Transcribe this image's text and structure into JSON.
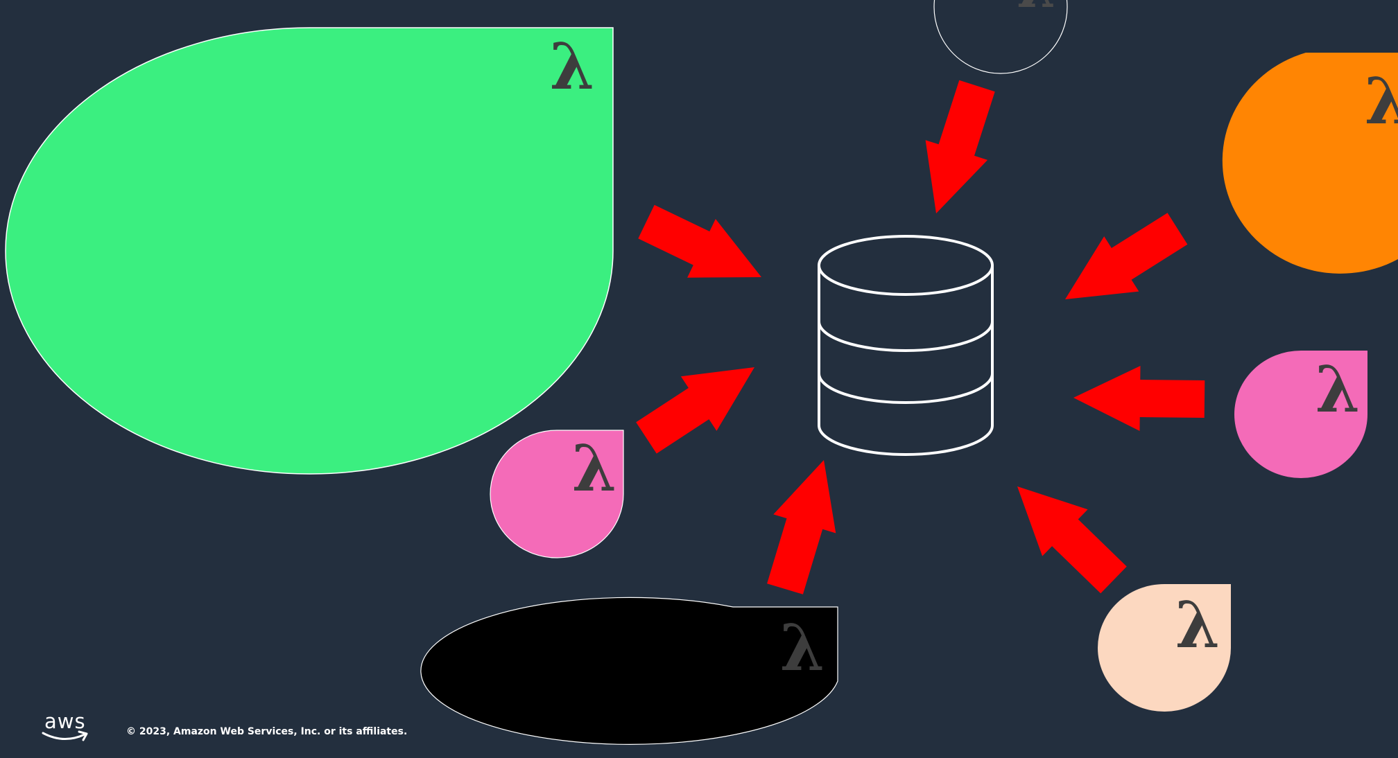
{
  "slide": {
    "background": "#232f3e",
    "arrow_color": "#ff0000",
    "database_icon": "database-cylinder-icon"
  },
  "functions": [
    {
      "id": "green",
      "symbol": "λ",
      "color": "#3bef80",
      "icon": "lambda-icon"
    },
    {
      "id": "gray-top",
      "symbol": "λ",
      "color": "#232f3e",
      "icon": "lambda-icon"
    },
    {
      "id": "orange",
      "symbol": "λ",
      "color": "#ff8503",
      "icon": "lambda-icon"
    },
    {
      "id": "pink-left",
      "symbol": "λ",
      "color": "#f46bb8",
      "icon": "lambda-icon"
    },
    {
      "id": "pink-right",
      "symbol": "λ",
      "color": "#f46bb8",
      "icon": "lambda-icon"
    },
    {
      "id": "black",
      "symbol": "λ",
      "color": "#000000",
      "icon": "lambda-icon"
    },
    {
      "id": "peach",
      "symbol": "λ",
      "color": "#fcd8c0",
      "icon": "lambda-icon"
    }
  ],
  "footer": {
    "logo_text": "aws",
    "logo_icon": "aws-logo-icon",
    "copyright": "© 2023, Amazon Web Services, Inc. or its affiliates."
  }
}
